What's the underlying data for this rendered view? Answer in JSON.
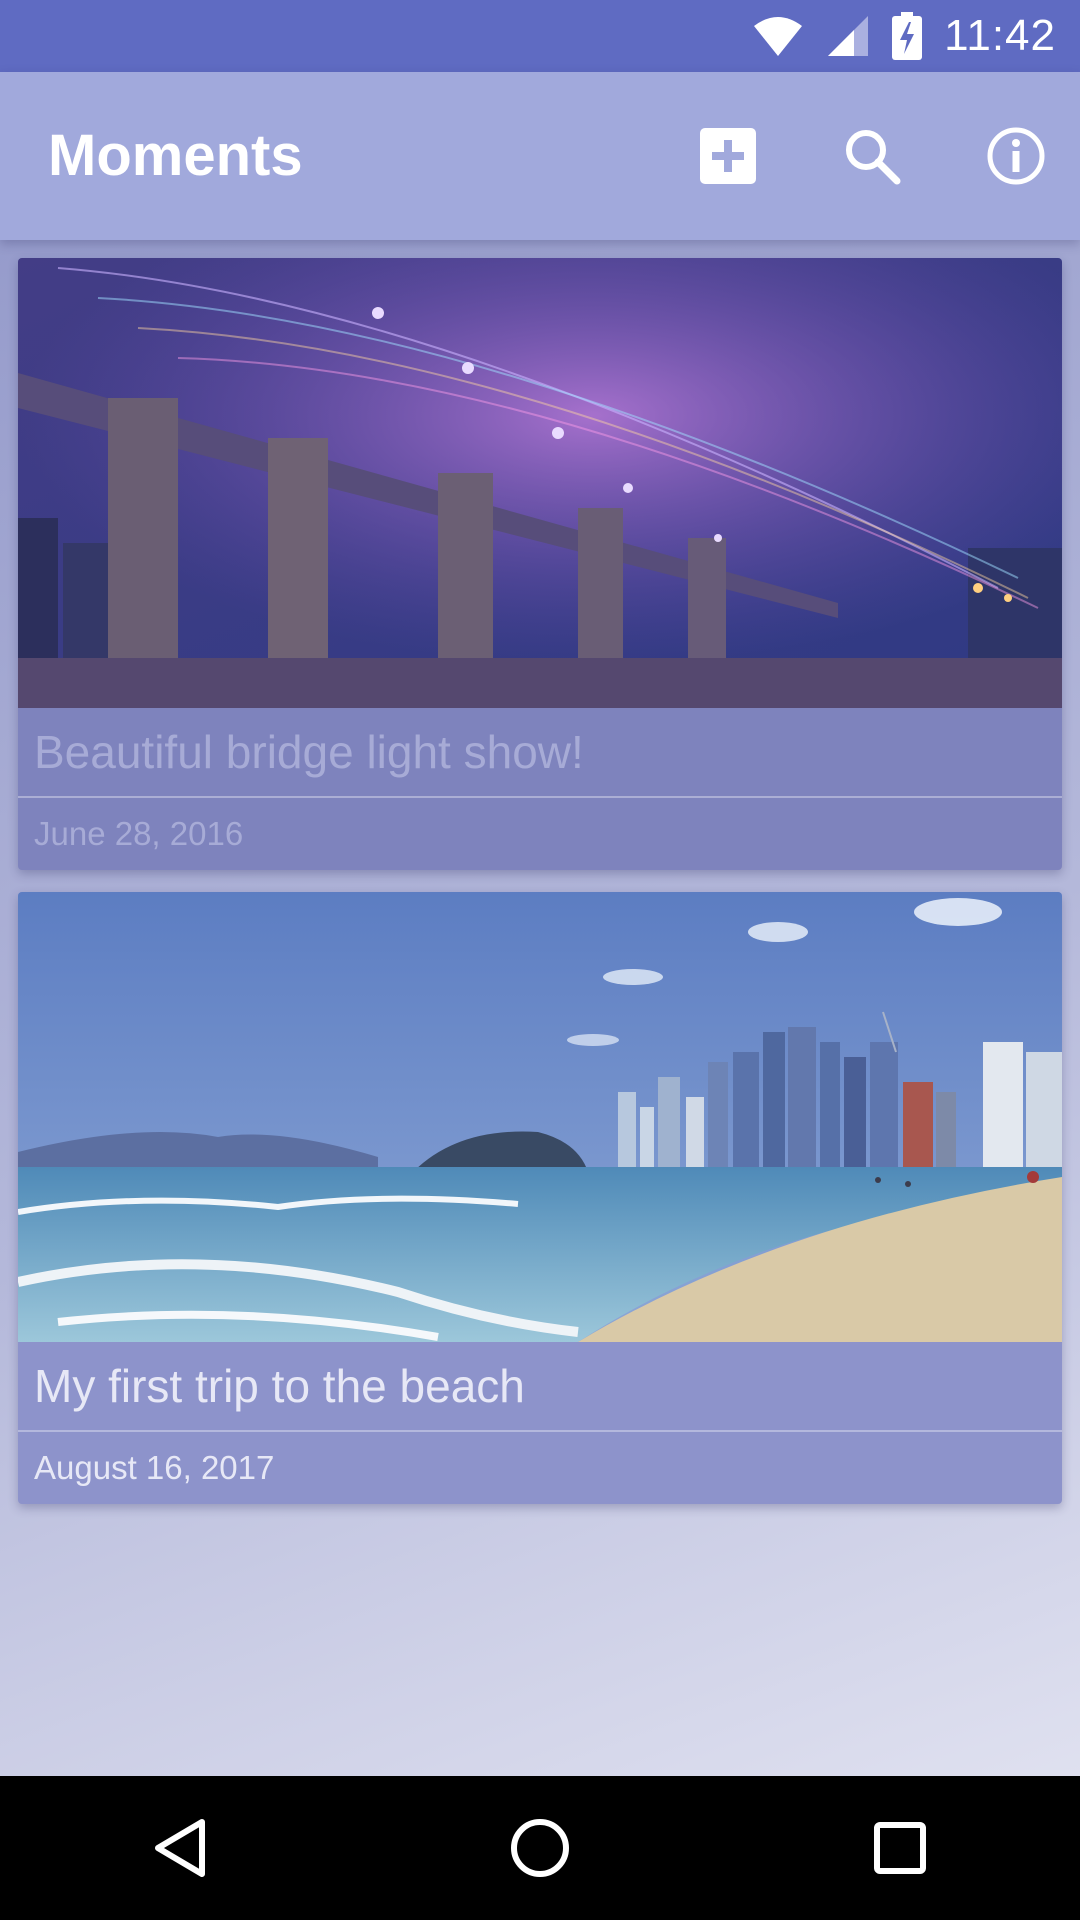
{
  "status_bar": {
    "time": "11:42",
    "icons": [
      "wifi-icon",
      "signal-icon",
      "battery-charging-icon"
    ]
  },
  "app_bar": {
    "title": "Moments",
    "actions": [
      "add-icon",
      "search-icon",
      "info-icon"
    ]
  },
  "moments": [
    {
      "title": "Beautiful bridge light show!",
      "date": "June 28, 2016",
      "image": "bridge-light-show-photo"
    },
    {
      "title": "My first trip to the beach",
      "date": "August 16, 2017",
      "image": "beach-city-photo"
    }
  ],
  "nav_bar": {
    "buttons": [
      "back-icon",
      "home-icon",
      "recents-icon"
    ]
  },
  "colors": {
    "status_bar": "#5f6bc2",
    "app_bar": "#a1a9dc",
    "card": "#8d93cb"
  }
}
